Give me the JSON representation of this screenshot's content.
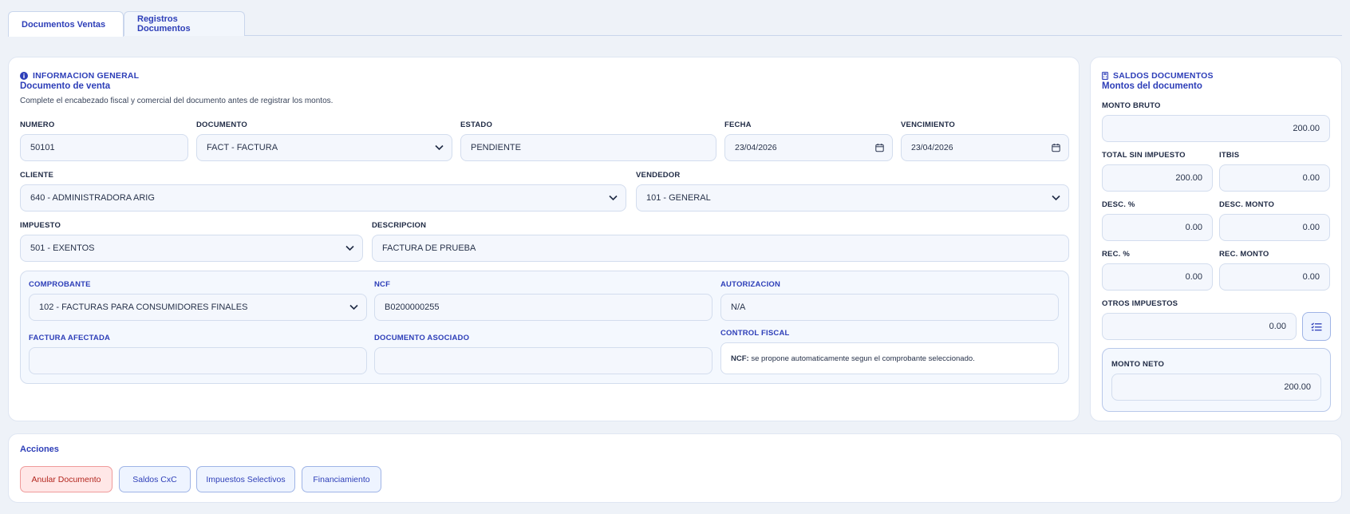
{
  "tabs": [
    {
      "label": "Documentos Ventas",
      "active": true
    },
    {
      "label": "Registros Documentos",
      "active": false
    }
  ],
  "general": {
    "title": "INFORMACION GENERAL",
    "subtitle": "Documento de venta",
    "description": "Complete el encabezado fiscal y comercial del documento antes de registrar los montos.",
    "numero": {
      "label": "NUMERO",
      "value": "50101"
    },
    "documento": {
      "label": "DOCUMENTO",
      "value": "FACT - FACTURA"
    },
    "estado": {
      "label": "ESTADO",
      "value": "PENDIENTE"
    },
    "fecha": {
      "label": "FECHA",
      "value": "23/04/2026"
    },
    "vencimiento": {
      "label": "VENCIMIENTO",
      "value": "23/04/2026"
    },
    "cliente": {
      "label": "CLIENTE",
      "value": "640 - ADMINISTRADORA ARIG"
    },
    "vendedor": {
      "label": "VENDEDOR",
      "value": "101 - GENERAL"
    },
    "impuesto": {
      "label": "IMPUESTO",
      "value": "501 - EXENTOS"
    },
    "descripcion": {
      "label": "DESCRIPCION",
      "value": "FACTURA DE PRUEBA"
    }
  },
  "fiscal": {
    "comprobante": {
      "label": "COMPROBANTE",
      "value": "102 - FACTURAS PARA CONSUMIDORES FINALES"
    },
    "ncf": {
      "label": "NCF",
      "value": "B0200000255"
    },
    "autorizacion": {
      "label": "AUTORIZACION",
      "value": "N/A"
    },
    "factura_afectada": {
      "label": "FACTURA AFECTADA",
      "value": ""
    },
    "documento_asociado": {
      "label": "DOCUMENTO ASOCIADO",
      "value": ""
    },
    "control_fiscal": {
      "label": "CONTROL FISCAL",
      "note_bold": "NCF:",
      "note_text": "se propone automaticamente segun el comprobante seleccionado."
    }
  },
  "saldos": {
    "title": "SALDOS DOCUMENTOS",
    "subtitle": "Montos del documento",
    "monto_bruto": {
      "label": "MONTO BRUTO",
      "value": "200.00"
    },
    "total_sin_impuesto": {
      "label": "TOTAL SIN IMPUESTO",
      "value": "200.00"
    },
    "itbis": {
      "label": "ITBIS",
      "value": "0.00"
    },
    "desc_pct": {
      "label": "DESC. %",
      "value": "0.00"
    },
    "desc_monto": {
      "label": "DESC. MONTO",
      "value": "0.00"
    },
    "rec_pct": {
      "label": "REC. %",
      "value": "0.00"
    },
    "rec_monto": {
      "label": "REC. MONTO",
      "value": "0.00"
    },
    "otros_impuestos": {
      "label": "OTROS IMPUESTOS",
      "value": "0.00"
    },
    "monto_neto": {
      "label": "MONTO NETO",
      "value": "200.00"
    }
  },
  "acciones": {
    "title": "Acciones",
    "anular": "Anular Documento",
    "saldos_cxc": "Saldos CxC",
    "impuestos_selectivos": "Impuestos Selectivos",
    "financiamiento": "Financiamiento"
  },
  "colors": {
    "accent": "#2d3eb8",
    "danger": "#b3261e",
    "field_bg": "#f4f7fd"
  }
}
